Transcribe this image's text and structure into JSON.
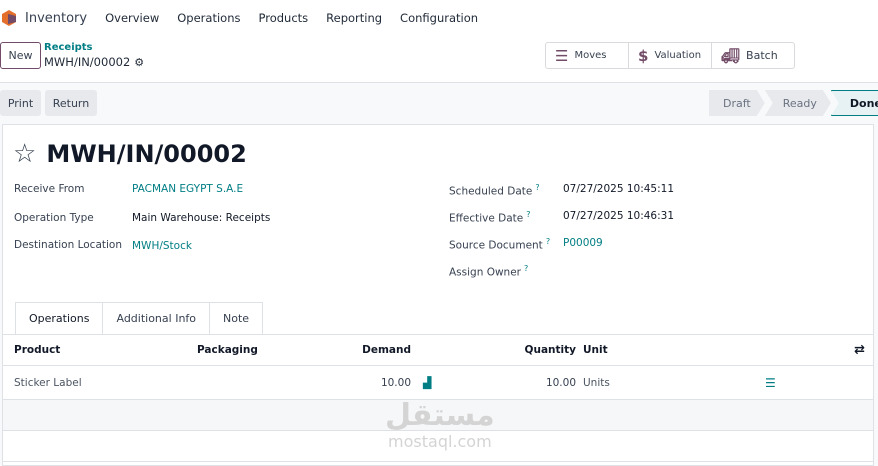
{
  "nav": {
    "app": "Inventory",
    "menu": [
      "Overview",
      "Operations",
      "Products",
      "Reporting",
      "Configuration"
    ]
  },
  "control": {
    "new": "New",
    "breadcrumb_parent": "Receipts",
    "breadcrumb_current": "MWH/IN/00002"
  },
  "stat_buttons": [
    {
      "icon": "bars-icon",
      "label": "Moves"
    },
    {
      "icon": "dollar-icon",
      "label": "Valuation"
    },
    {
      "icon": "truck-icon",
      "label": "Batch"
    }
  ],
  "actions": {
    "print": "Print",
    "return": "Return"
  },
  "statusbar": {
    "steps": [
      "Draft",
      "Ready",
      "Done"
    ],
    "active": "Done"
  },
  "record": {
    "name": "MWH/IN/00002",
    "left": [
      {
        "label": "Receive From",
        "value": "PACMAN EGYPT S.A.E",
        "link": true
      },
      {
        "label": "Operation Type",
        "value": "Main Warehouse: Receipts",
        "link": false
      },
      {
        "label": "Destination Location",
        "value": "MWH/Stock",
        "link": true
      }
    ],
    "right": [
      {
        "label": "Scheduled Date",
        "value": "07/27/2025 10:45:11"
      },
      {
        "label": "Effective Date",
        "value": "07/27/2025 10:46:31"
      },
      {
        "label": "Source Document",
        "value": "P00009"
      },
      {
        "label": "Assign Owner",
        "value": ""
      }
    ]
  },
  "tabs": [
    "Operations",
    "Additional Info",
    "Note"
  ],
  "table": {
    "headers": {
      "product": "Product",
      "packaging": "Packaging",
      "demand": "Demand",
      "quantity": "Quantity",
      "unit": "Unit"
    },
    "rows": [
      {
        "product": "Sticker Label",
        "packaging": "",
        "demand": "10.00",
        "quantity": "10.00",
        "unit": "Units"
      }
    ]
  },
  "watermark": {
    "arabic": "مستقل",
    "latin": "mostaql.com"
  },
  "colors": {
    "accent": "#017e84",
    "brand": "#714b67"
  }
}
